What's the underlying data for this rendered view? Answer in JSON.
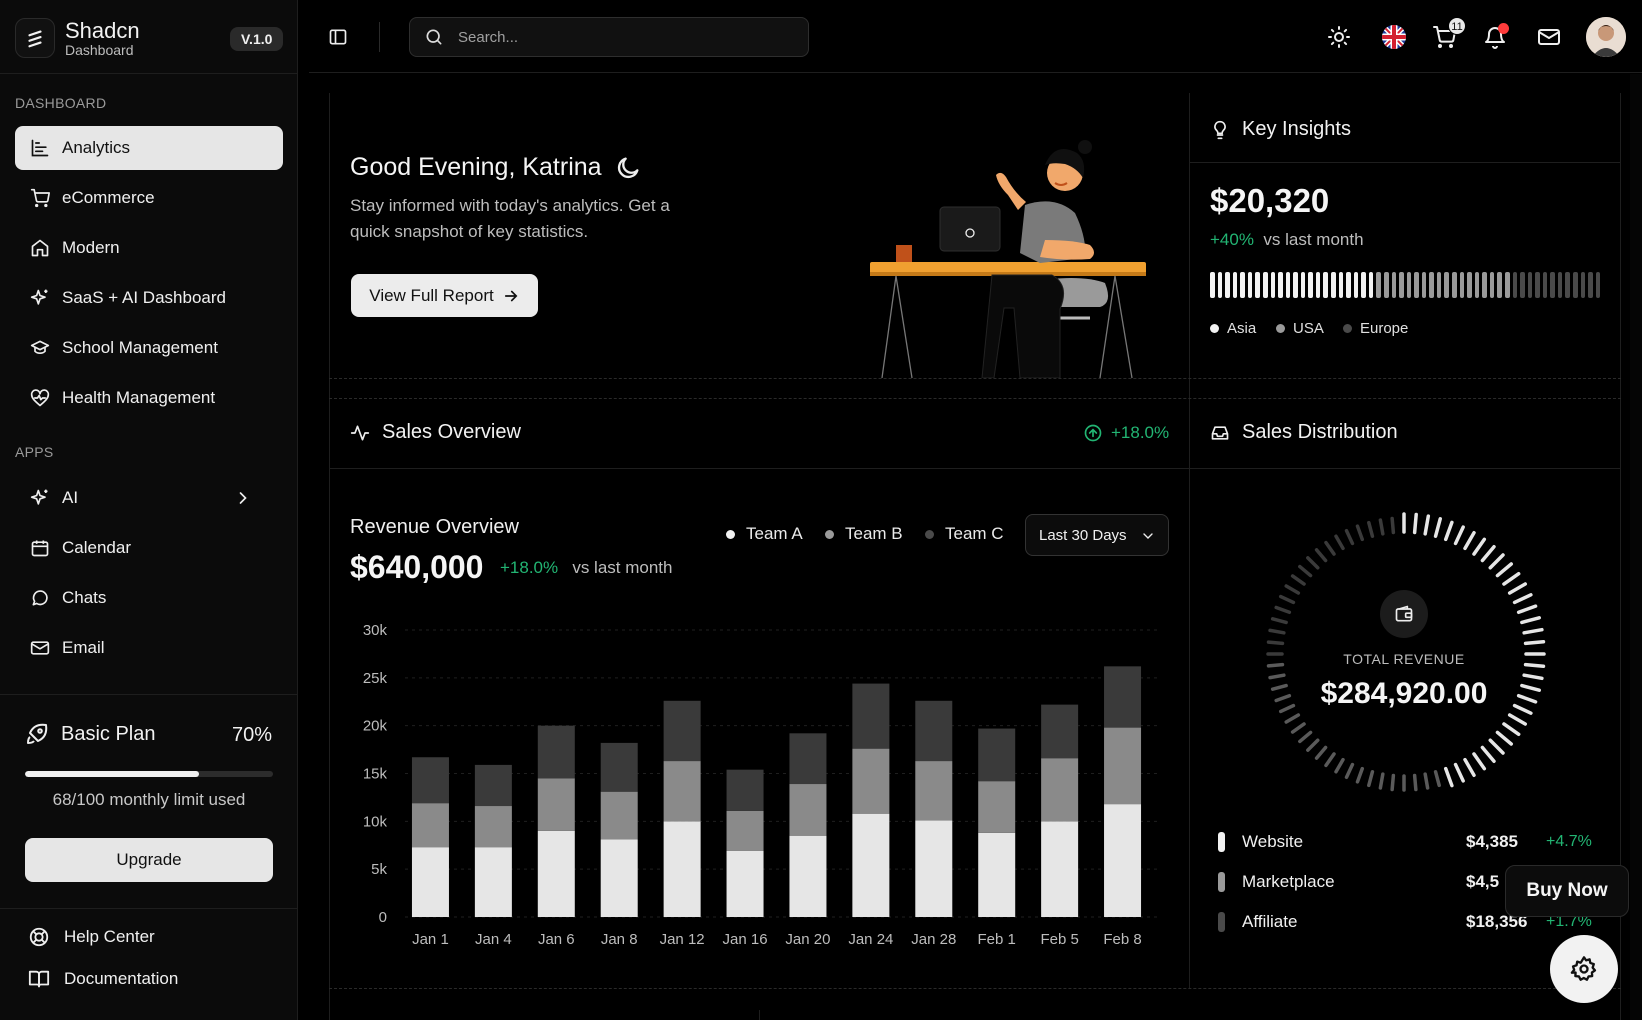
{
  "brand": {
    "name": "Shadcn",
    "subtitle": "Dashboard",
    "version": "V.1.0"
  },
  "sidebar": {
    "dashboard_section": "DASHBOARD",
    "dashboard_items": [
      {
        "label": "Analytics",
        "icon": "chart-icon",
        "active": true
      },
      {
        "label": "eCommerce",
        "icon": "cart-icon"
      },
      {
        "label": "Modern",
        "icon": "home-icon"
      },
      {
        "label": "SaaS + AI Dashboard",
        "icon": "sparkles-icon"
      },
      {
        "label": "School Management",
        "icon": "graduation-cap-icon"
      },
      {
        "label": "Health Management",
        "icon": "heart-pulse-icon"
      }
    ],
    "apps_section": "APPS",
    "app_items": [
      {
        "label": "AI",
        "icon": "sparkles-icon",
        "has_submenu": true
      },
      {
        "label": "Calendar",
        "icon": "calendar-icon"
      },
      {
        "label": "Chats",
        "icon": "chat-icon"
      },
      {
        "label": "Email",
        "icon": "mail-icon"
      }
    ],
    "plan": {
      "title": "Basic Plan",
      "percent_label": "70%",
      "progress": 0.7,
      "note": "68/100 monthly limit used",
      "upgrade_label": "Upgrade"
    },
    "footer_items": [
      {
        "label": "Help Center",
        "icon": "help-icon"
      },
      {
        "label": "Documentation",
        "icon": "book-icon"
      }
    ]
  },
  "topbar": {
    "search_placeholder": "Search...",
    "cart_count": "11",
    "icons": [
      "sidebar-toggle-icon",
      "sun-icon",
      "uk-flag-icon",
      "cart-icon",
      "bell-icon",
      "mail-icon",
      "avatar"
    ]
  },
  "welcome": {
    "greeting": "Good Evening, Katrina",
    "subtitle": "Stay informed with today's analytics. Get a quick snapshot of key statistics.",
    "cta_label": "View Full Report"
  },
  "key_insights": {
    "title": "Key Insights",
    "value": "$20,320",
    "change": "+40%",
    "change_suffix": "vs last month",
    "legend": [
      {
        "label": "Asia",
        "color": "#f2f2f2"
      },
      {
        "label": "USA",
        "color": "#9a9a9a"
      },
      {
        "label": "Europe",
        "color": "#4a4a4a"
      }
    ]
  },
  "sales_overview": {
    "title": "Sales Overview",
    "change": "+18.0%",
    "revenue_title": "Revenue Overview",
    "revenue_value": "$640,000",
    "revenue_change": "+18.0%",
    "revenue_change_suffix": "vs last month",
    "range_label": "Last 30 Days"
  },
  "chart_data": {
    "type": "bar",
    "stacked": true,
    "categories": [
      "Jan 1",
      "Jan 4",
      "Jan 6",
      "Jan 8",
      "Jan 12",
      "Jan 16",
      "Jan 20",
      "Jan 24",
      "Jan 28",
      "Feb 1",
      "Feb 5",
      "Feb 8"
    ],
    "series": [
      {
        "name": "Team A",
        "color": "#e6e6e6",
        "values": [
          7300,
          7300,
          9000,
          8100,
          10000,
          6900,
          8500,
          10800,
          10100,
          8800,
          10000,
          11800
        ]
      },
      {
        "name": "Team B",
        "color": "#8a8a8a",
        "values": [
          4600,
          4300,
          5500,
          5000,
          6300,
          4200,
          5400,
          6800,
          6200,
          5400,
          6600,
          8000
        ]
      },
      {
        "name": "Team C",
        "color": "#3a3a3a",
        "values": [
          4800,
          4300,
          5500,
          5100,
          6300,
          4300,
          5300,
          6800,
          6300,
          5500,
          5600,
          6400
        ]
      }
    ],
    "yticks": [
      "0",
      "5k",
      "10k",
      "15k",
      "20k",
      "25k",
      "30k"
    ],
    "ylim": [
      0,
      30000
    ],
    "grid": true
  },
  "sales_distribution": {
    "title": "Sales Distribution",
    "center_label": "TOTAL REVENUE",
    "center_value": "$284,920.00",
    "rows": [
      {
        "name": "Website",
        "amount": "$4,385",
        "change": "+4.7%",
        "color": "#f2f2f2"
      },
      {
        "name": "Marketplace",
        "amount": "$4,5",
        "change": "",
        "color": "#9a9a9a"
      },
      {
        "name": "Affiliate",
        "amount": "$18,356",
        "change": "+1.7%",
        "color": "#4a4a4a"
      }
    ]
  },
  "floating": {
    "buy_now": "Buy Now"
  }
}
